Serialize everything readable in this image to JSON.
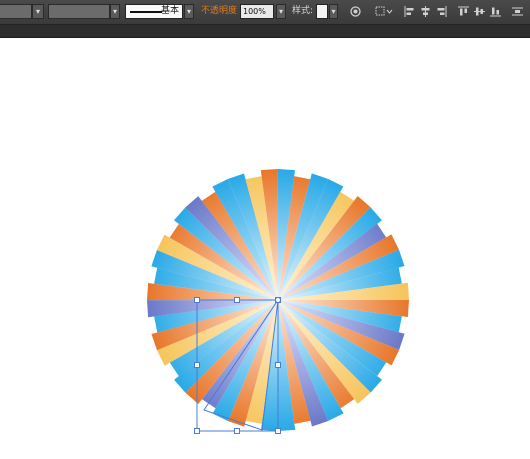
{
  "toolbar": {
    "stroke_style_label": "基本",
    "opacity_label": "不透明度",
    "opacity_value": "100%",
    "style_label": "样式:",
    "dropdown_glyph": "▾"
  },
  "icons": [
    "recolor-icon",
    "align-options-icon",
    "align-left-icon",
    "align-center-icon",
    "align-right-icon",
    "align-top-icon",
    "align-middle-icon",
    "align-bottom-icon",
    "distribute-icon"
  ],
  "colors": {
    "toolbar_bg": "#3c3c3c",
    "accent_label": "#e07a1f",
    "selection": "#4a7bd6",
    "wedge_blue": "#29a9e6",
    "wedge_orange": "#e8762a",
    "wedge_yellow": "#f6c45a",
    "wedge_violet": "#6a78c8"
  },
  "artwork": {
    "shape": "radial-gradient-sunburst",
    "selection_active": true
  }
}
